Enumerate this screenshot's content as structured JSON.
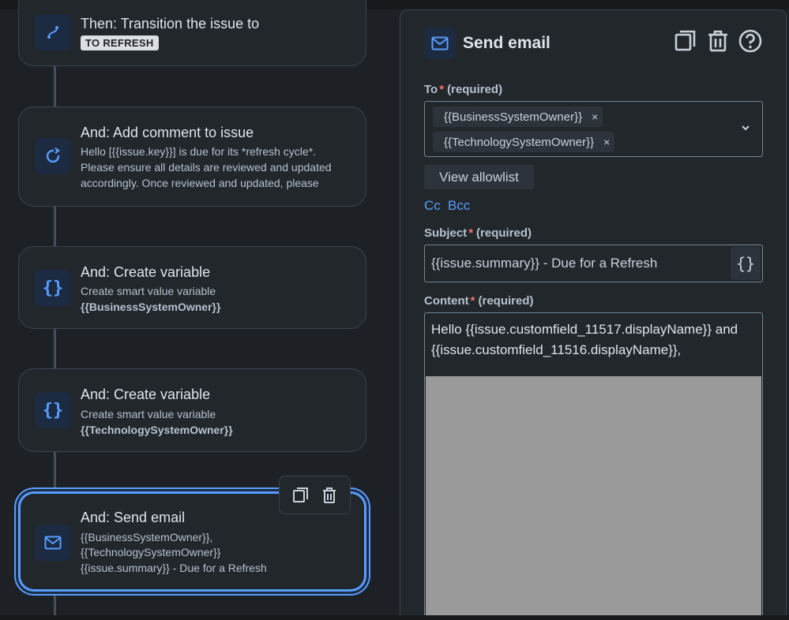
{
  "flow": {
    "cards": [
      {
        "title": "Then: Transition the issue to",
        "lozenge": "TO REFRESH",
        "icon": "transition-icon"
      },
      {
        "title": "And: Add comment to issue",
        "desc": [
          "Hello [{{issue.key}}] is due for its *refresh cycle*.",
          "Please ensure all details are reviewed and updated",
          "accordingly. Once reviewed and updated, please"
        ],
        "icon": "comment-refresh-icon"
      },
      {
        "title": "And: Create variable",
        "desc": [
          "Create smart value variable"
        ],
        "bold": "{{BusinessSystemOwner}}",
        "icon": "braces-icon"
      },
      {
        "title": "And: Create variable",
        "desc": [
          "Create smart value variable"
        ],
        "bold": "{{TechnologySystemOwner}}",
        "icon": "braces-icon"
      },
      {
        "title": "And: Send email",
        "desc": [
          "{{BusinessSystemOwner}},",
          "{{TechnologySystemOwner}}",
          "{{issue.summary}} - Due for a Refresh"
        ],
        "icon": "mail-icon"
      }
    ]
  },
  "panel": {
    "title": "Send email",
    "to": {
      "label": "To",
      "required": "(required)",
      "chips": [
        "{{BusinessSystemOwner}}",
        "{{TechnologySystemOwner}}"
      ],
      "remove_glyph": "×"
    },
    "allowlist_label": "View allowlist",
    "cc_label": "Cc",
    "bcc_label": "Bcc",
    "subject": {
      "label": "Subject",
      "required": "(required)",
      "value": "{{issue.summary}} - Due for a Refresh"
    },
    "content": {
      "label": "Content",
      "required": "(required)",
      "lines": [
        "Hello {{issue.customfield_11517.displayName}} and",
        "{{issue.customfield_11516.displayName}},"
      ]
    },
    "asterisk": "*"
  },
  "colors": {
    "accent": "#579dff",
    "background": "#1d2125",
    "surface": "#22272b",
    "required": "#f87168"
  }
}
